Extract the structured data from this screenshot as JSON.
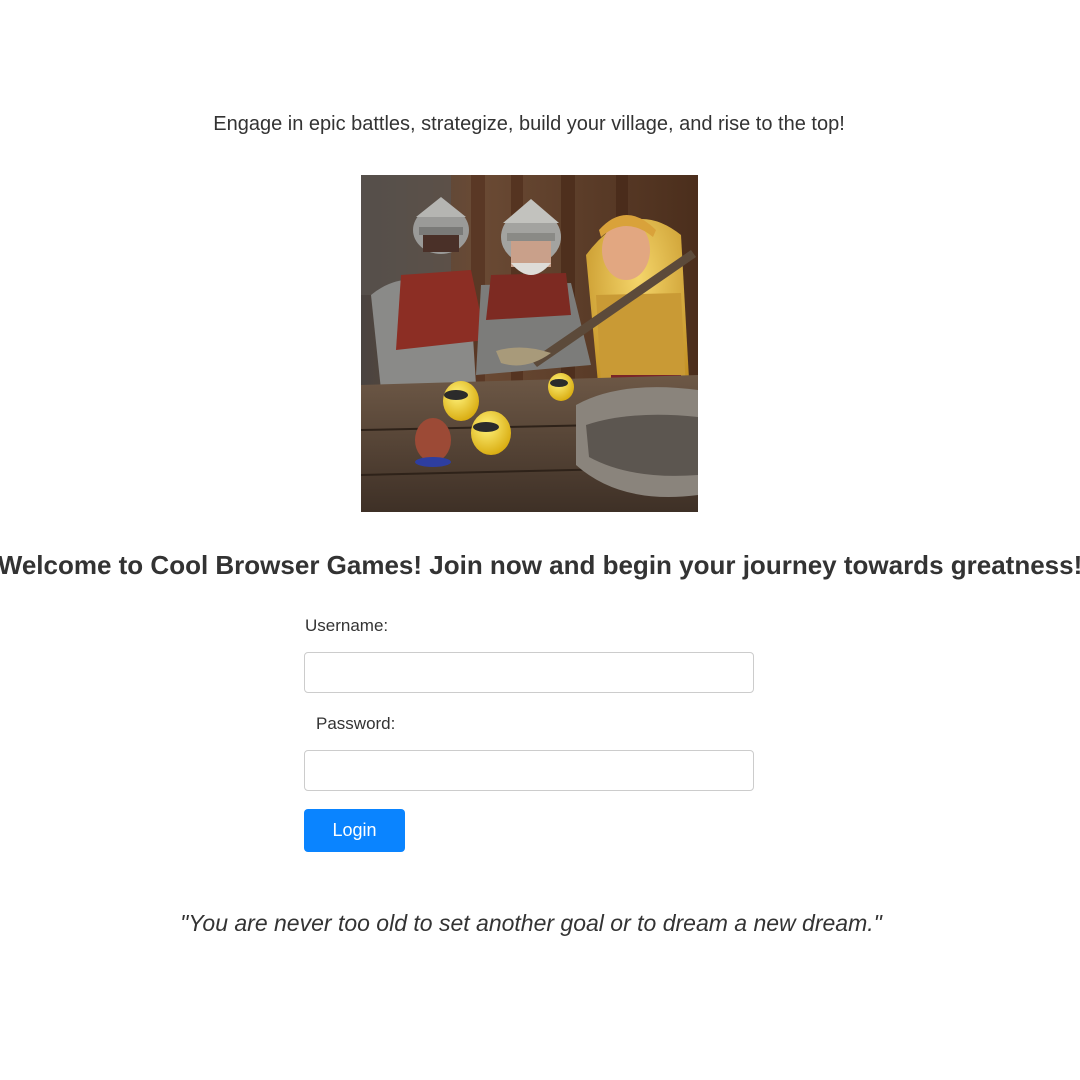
{
  "tagline": "Engage in epic battles, strategize, build your village, and rise to the top!",
  "hero_image": {
    "icon": "fantasy-warriors-illustration"
  },
  "welcome": "Welcome to Cool Browser Games! Join now and begin your journey towards greatness!",
  "form": {
    "username_label": "Username:",
    "username_value": "",
    "password_label": "Password:",
    "password_value": "",
    "login_label": "Login"
  },
  "quote": "\"You are never too old to set another goal or to dream a new dream.\"",
  "colors": {
    "accent": "#0a84ff",
    "text": "#333333",
    "background": "#ffffff"
  }
}
